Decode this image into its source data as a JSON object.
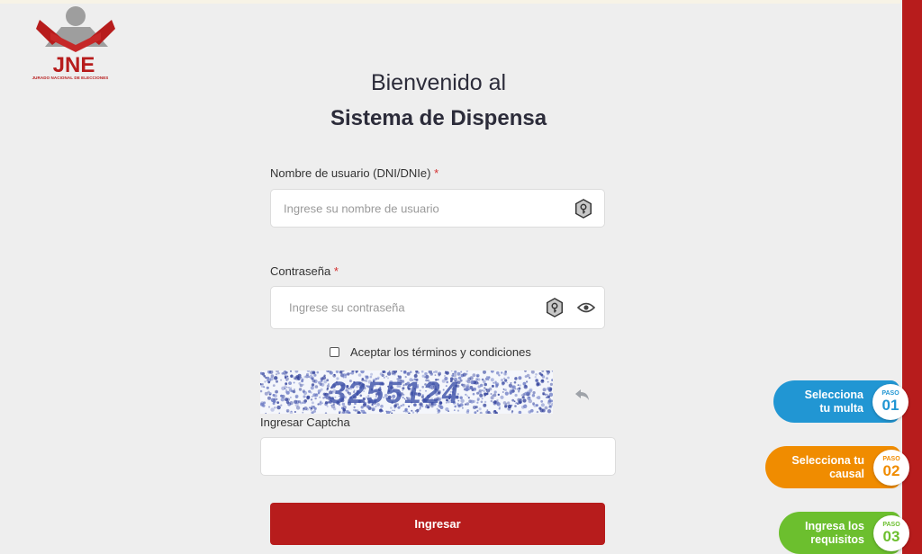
{
  "logo": {
    "text": "JNE",
    "caption": "JURADO NACIONAL DE ELECCIONES"
  },
  "welcome": {
    "line1": "Bienvenido al",
    "line2": "Sistema de Dispensa"
  },
  "username": {
    "label": "Nombre de usuario (DNI/DNIe)",
    "required_mark": "*",
    "placeholder": "Ingrese su nombre de usuario"
  },
  "password": {
    "label": "Contraseña",
    "required_mark": "*",
    "placeholder": "Ingrese su contraseña"
  },
  "terms": {
    "label": "Aceptar los términos y condiciones",
    "checked": false
  },
  "captcha": {
    "label": "Ingresar Captcha",
    "value": ""
  },
  "submit": {
    "label": "Ingresar"
  },
  "steps": [
    {
      "line1": "Selecciona",
      "line2": "tu multa",
      "paso": "PASO",
      "num": "01",
      "color": "#2196d3"
    },
    {
      "line1": "Selecciona tu",
      "line2": "causal",
      "paso": "PASO",
      "num": "02",
      "color": "#f08c00"
    },
    {
      "line1": "Ingresa los",
      "line2": "requisitos",
      "paso": "PASO",
      "num": "03",
      "color": "#6cbf2e"
    }
  ],
  "colors": {
    "brand_red": "#b71c1c",
    "background": "#eeeeee"
  }
}
